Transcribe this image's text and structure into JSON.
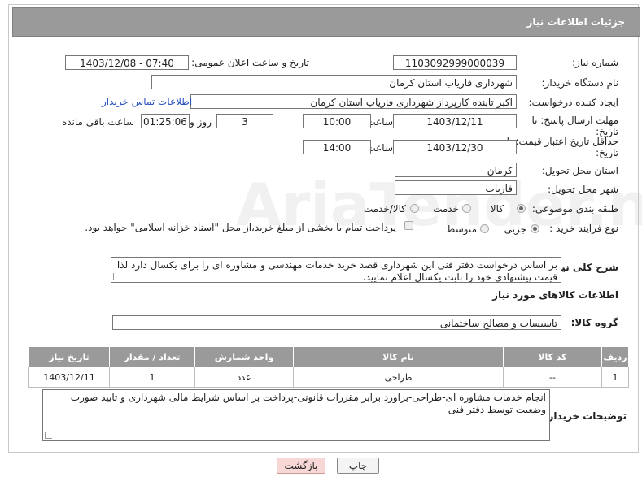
{
  "header": {
    "title": "جزئیات اطلاعات نیاز"
  },
  "labels": {
    "need_number": "شماره نیاز:",
    "announce_datetime": "تاریخ و ساعت اعلان عمومی:",
    "buyer_org": "نام دستگاه خریدار:",
    "creator": "ایجاد کننده درخواست:",
    "reply_deadline_1": "مهلت ارسال پاسخ: تا",
    "reply_deadline_2": "تاریخ:",
    "time": "ساعت",
    "day_and": "روز و",
    "remaining": "ساعت باقی مانده",
    "price_validity_1": "حداقل تاریخ اعتبار قیمت: تا",
    "price_validity_2": "تاریخ:",
    "delivery_province": "استان محل تحویل:",
    "delivery_city": "شهر محل تحویل:",
    "category": "طبقه بندی موضوعی:",
    "purchase_type": "نوع فرآیند خرید :",
    "general_desc": "شرح کلی نیاز:",
    "goods_info": "اطلاعات کالاهای مورد نیاز",
    "goods_group": "گروه کالا:",
    "buyer_notes": "توضیحات خریدار:"
  },
  "values": {
    "need_number": "1103092999000039",
    "announce_datetime": "1403/12/08 - 07:40",
    "buyer_org": "شهرداری فاریاب استان کرمان",
    "creator": "اکبر تابنده کارپرداز شهرداری فاریاب استان کرمان",
    "contact_link": "اطلاعات تماس خریدار",
    "reply_date": "1403/12/11",
    "reply_time": "10:00",
    "reply_days": "3",
    "reply_remaining": "01:25:06",
    "price_date": "1403/12/30",
    "price_time": "14:00",
    "province": "کرمان",
    "city": "فاریاب",
    "general_desc": "بر اساس درخواست دفتر فنی این شهرداری قصد خرید خدمات مهندسی و مشاوره ای را برای یکسال دارد لذا قیمت پیشنهادی خود را بابت یکسال اعلام نمایید.",
    "goods_group": "تاسیسات و مصالح ساختمانی",
    "buyer_notes": "انجام خدمات مشاوره ای-طراحی-براورد برابر مقررات قانونی-پرداخت بر اساس شرایط مالی شهرداری و تایید صورت وضعیت توسط دفتر فنی"
  },
  "category_options": [
    {
      "label": "کالا",
      "selected": true
    },
    {
      "label": "خدمت",
      "selected": false
    },
    {
      "label": "کالا/خدمت",
      "selected": false
    }
  ],
  "purchase_options": [
    {
      "label": "جزیی",
      "selected": true
    },
    {
      "label": "متوسط",
      "selected": false
    }
  ],
  "payment_note": "پرداخت تمام یا بخشی از مبلغ خرید،از محل \"اسناد خزانه اسلامی\" خواهد بود.",
  "table": {
    "headers": [
      "ردیف",
      "کد کالا",
      "نام کالا",
      "واحد شمارش",
      "تعداد / مقدار",
      "تاریخ نیاز"
    ],
    "rows": [
      [
        "1",
        "--",
        "طراحی",
        "عدد",
        "1",
        "1403/12/11"
      ]
    ]
  },
  "buttons": {
    "print": "چاپ",
    "back": "بازگشت"
  },
  "watermark": "AriaTender.net"
}
